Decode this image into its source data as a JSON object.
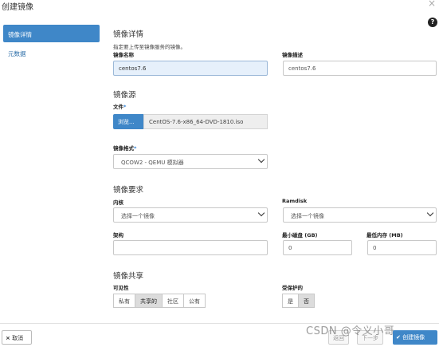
{
  "dialog": {
    "title": "创建镜像",
    "close": "×",
    "help": "?"
  },
  "sidebar": {
    "items": [
      {
        "label": "镜像详情"
      },
      {
        "label": "元数据"
      }
    ]
  },
  "details": {
    "title": "镜像详情",
    "hint": "指定要上传至镜像服务的镜像。",
    "name_label": "镜像名称",
    "name_value": "centos7.6",
    "desc_label": "镜像描述",
    "desc_value": "centos7.6"
  },
  "source": {
    "title": "镜像源",
    "file_label": "文件",
    "required_mark": "*",
    "browse_label": "浏览...",
    "file_name": "CentOS-7.6-x86_64-DVD-1810.iso"
  },
  "format": {
    "label": "镜像格式",
    "required_mark": "*",
    "value": "QCOW2 - QEMU 模拟器"
  },
  "requirements": {
    "title": "镜像要求",
    "kernel_label": "内核",
    "kernel_value": "选择一个镜像",
    "ramdisk_label": "Ramdisk",
    "ramdisk_value": "选择一个镜像",
    "arch_label": "架构",
    "arch_value": "",
    "min_disk_label": "最小磁盘 (GB)",
    "min_disk_value": "0",
    "min_ram_label": "最低内存 (MB)",
    "min_ram_value": "0"
  },
  "sharing": {
    "title": "镜像共享",
    "visibility_label": "可见性",
    "visibility_options": [
      "私有",
      "共享的",
      "社区",
      "公有"
    ],
    "visibility_selected": "共享的",
    "protected_label": "受保护的",
    "protected_options": [
      "是",
      "否"
    ],
    "protected_selected": "否"
  },
  "footer": {
    "cancel_label": "取消",
    "cancel_icon": "×",
    "back_label": "返回",
    "next_label": "下一步",
    "create_label": "创建镜像"
  },
  "watermark": "CSDN @令义小哥",
  "colors": {
    "accent": "#3f87c8",
    "selected_segment": "#dcdcdc",
    "focused_input": "#e6f0fb"
  }
}
